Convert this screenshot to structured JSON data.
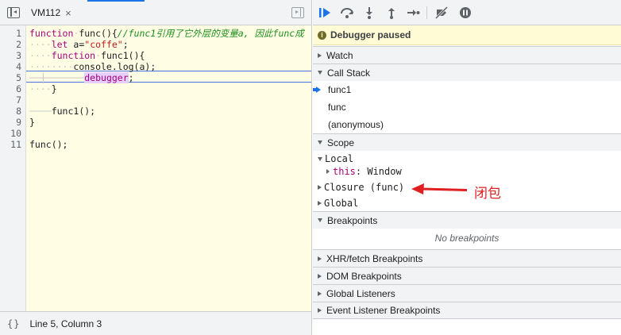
{
  "editor": {
    "tab_label": "VM112",
    "close_glyph": "×",
    "status_braces": "{}",
    "status_position": "Line 5, Column 3",
    "line_numbers": [
      "1",
      "2",
      "3",
      "4",
      "5",
      "6",
      "7",
      "8",
      "9",
      "10",
      "11"
    ]
  },
  "code": {
    "l1_kw": "function",
    "l1_rest": "func(){",
    "l1_comment": "//func1引用了它外层的变量a, 因此func成",
    "l2_kw": "let",
    "l2_mid": " a=",
    "l2_str": "\"coffe\"",
    "l2_end": ";",
    "l3_kw": "function",
    "l3_rest": "func1(){",
    "l4_code": "console.log(a);",
    "l5_debugger": "debugger",
    "l5_end": ";",
    "l6_code": "}",
    "l8_code": "func1();",
    "l9_code": "}",
    "l11_code": "func();"
  },
  "debugger": {
    "banner": "Debugger paused",
    "sections": {
      "watch": "Watch",
      "call_stack": "Call Stack",
      "scope": "Scope",
      "breakpoints": "Breakpoints",
      "xhr": "XHR/fetch Breakpoints",
      "dom": "DOM Breakpoints",
      "global_listeners": "Global Listeners",
      "event_listener": "Event Listener Breakpoints"
    },
    "call_stack": [
      "func1",
      "func",
      "(anonymous)"
    ],
    "scope": {
      "local": "Local",
      "this_key": "this",
      "this_val": ": Window",
      "closure": "Closure (func)",
      "global": "Global"
    },
    "no_breakpoints": "No breakpoints"
  },
  "annotation": {
    "text": "闭包",
    "color": "#e02020"
  },
  "colors": {
    "accent": "#1a73e8",
    "keyword": "#a6007c",
    "string": "#c41a16",
    "comment": "#1d8d1d",
    "code_bg": "#fffee5",
    "banner_bg": "#fffbd5"
  },
  "icons": [
    "toggle-navigator-icon",
    "toggle-debugger-sidebar-icon",
    "resume-icon",
    "step-over-icon",
    "step-into-icon",
    "step-out-icon",
    "step-icon",
    "deactivate-breakpoints-icon",
    "pause-on-exceptions-icon",
    "info-icon",
    "call-frame-arrow-icon",
    "red-arrow-icon"
  ]
}
